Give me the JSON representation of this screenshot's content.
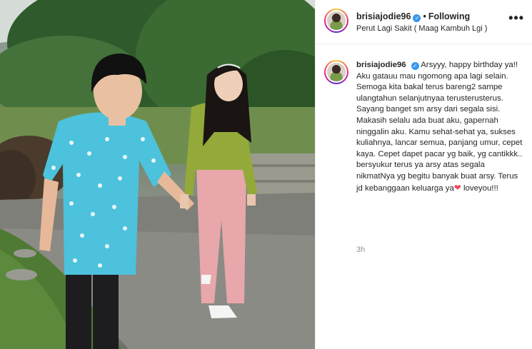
{
  "post": {
    "photo_alt": "photo-area",
    "header": {
      "username": "brisiajodie96",
      "verified_symbol": "✓",
      "separator": "•",
      "follow_status": "Following",
      "location": "Perut Lagi Sakit ( Maag Kambuh Lgi )",
      "more_symbol": "•••"
    },
    "caption": {
      "username": "brisiajodie96",
      "verified_symbol": "✓",
      "text_before_heart": "Arsyyy, happy birthday ya!! Aku gatauu mau ngomong apa lagi selain. Semoga kita bakal terus bareng2 sampe ulangtahun selanjutnyaa terusterusterus. Sayang banget sm arsy dari segala sisi. Makasih selalu ada buat aku, gapernah ninggalin aku. Kamu sehat-sehat ya, sukses kuliahnya, lancar semua, panjang umur, cepet kaya. Cepet dapet pacar yg baik, yg cantikkk.. bersyukur terus ya arsy atas segala nikmatNya yg begitu banyak buat arsy. Terus jd kebanggaan keluarga ya",
      "heart_symbol": "❤",
      "text_after_heart": " loveyou!!!"
    },
    "timestamp": "3h"
  },
  "colors": {
    "verified": "#3897f0",
    "heart": "#ed4956",
    "muted": "#8e8e8e",
    "text": "#262626"
  }
}
